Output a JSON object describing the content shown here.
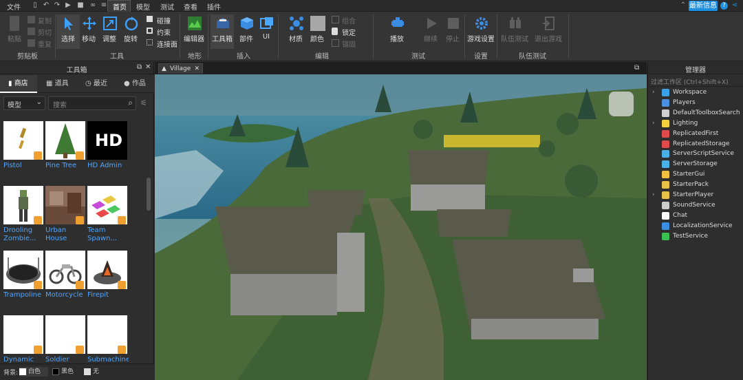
{
  "menubar": {
    "file": "文件",
    "tabs": [
      "首页",
      "模型",
      "测试",
      "查看",
      "插件"
    ],
    "news": "最新信息"
  },
  "ribbon": {
    "clipboard": {
      "paste": "粘贴",
      "copy": "复制",
      "cut": "剪切",
      "duplicate": "重复",
      "group": "剪贴板"
    },
    "tools": {
      "select": "选择",
      "move": "移动",
      "scale": "调整",
      "rotate": "旋转",
      "collide": "碰撞",
      "constraint": "约束",
      "join": "连接面",
      "group": "工具"
    },
    "terrain": {
      "editor": "编辑器",
      "group": "地形"
    },
    "insert": {
      "toolbox": "工具箱",
      "part": "部件",
      "ui": "UI",
      "group": "插入"
    },
    "edit": {
      "material": "材质",
      "color": "颜色",
      "group_btn": "组合",
      "lock": "锁定",
      "anchor": "锚固",
      "group": "编辑"
    },
    "test": {
      "play": "播放",
      "resume": "继续",
      "stop": "停止",
      "group": "测试"
    },
    "settings": {
      "game_settings": "游戏设置",
      "group": "设置"
    },
    "team_test": {
      "team_test": "队伍测试",
      "exit": "退出游戏",
      "group": "队伍测试"
    }
  },
  "toolbox": {
    "title": "工具箱",
    "tabs": [
      "商店",
      "道具",
      "最近",
      "作品"
    ],
    "filter": "模型",
    "search_placeholder": "搜索",
    "assets": [
      {
        "name": "Pistol"
      },
      {
        "name": "Pine Tree"
      },
      {
        "name": "HD Admin"
      },
      {
        "name": "Drooling Zombie..."
      },
      {
        "name": "Urban House"
      },
      {
        "name": "Team Spawn..."
      },
      {
        "name": "Trampoline"
      },
      {
        "name": "Motorcycle"
      },
      {
        "name": "Firepit"
      },
      {
        "name": "Dynamic"
      },
      {
        "name": "Soldier"
      },
      {
        "name": "Submachine"
      }
    ],
    "bg_label": "背景:",
    "bg_options": [
      "白色",
      "黑色",
      "无"
    ]
  },
  "viewport": {
    "tab": "Village",
    "hd_text": "HD"
  },
  "explorer": {
    "title": "管理器",
    "filter_placeholder": "过滤工作区 (Ctrl+Shift+X)",
    "items": [
      {
        "label": "Workspace",
        "expandable": true,
        "color": "#3aa0e8"
      },
      {
        "label": "Players",
        "expandable": false,
        "color": "#4a8fe0"
      },
      {
        "label": "DefaultToolboxSearch",
        "expandable": false,
        "color": "#d0d0d0"
      },
      {
        "label": "Lighting",
        "expandable": true,
        "color": "#f2d23c"
      },
      {
        "label": "ReplicatedFirst",
        "expandable": false,
        "color": "#e04a4a"
      },
      {
        "label": "ReplicatedStorage",
        "expandable": false,
        "color": "#e04a4a"
      },
      {
        "label": "ServerScriptService",
        "expandable": false,
        "color": "#4ab0e8"
      },
      {
        "label": "ServerStorage",
        "expandable": false,
        "color": "#4ab0e8"
      },
      {
        "label": "StarterGui",
        "expandable": false,
        "color": "#f0c040"
      },
      {
        "label": "StarterPack",
        "expandable": false,
        "color": "#e8c048"
      },
      {
        "label": "StarterPlayer",
        "expandable": true,
        "color": "#e8c048"
      },
      {
        "label": "SoundService",
        "expandable": false,
        "color": "#cccccc"
      },
      {
        "label": "Chat",
        "expandable": false,
        "color": "#ffffff"
      },
      {
        "label": "LocalizationService",
        "expandable": false,
        "color": "#3a8de0"
      },
      {
        "label": "TestService",
        "expandable": false,
        "color": "#3ac050"
      }
    ]
  }
}
